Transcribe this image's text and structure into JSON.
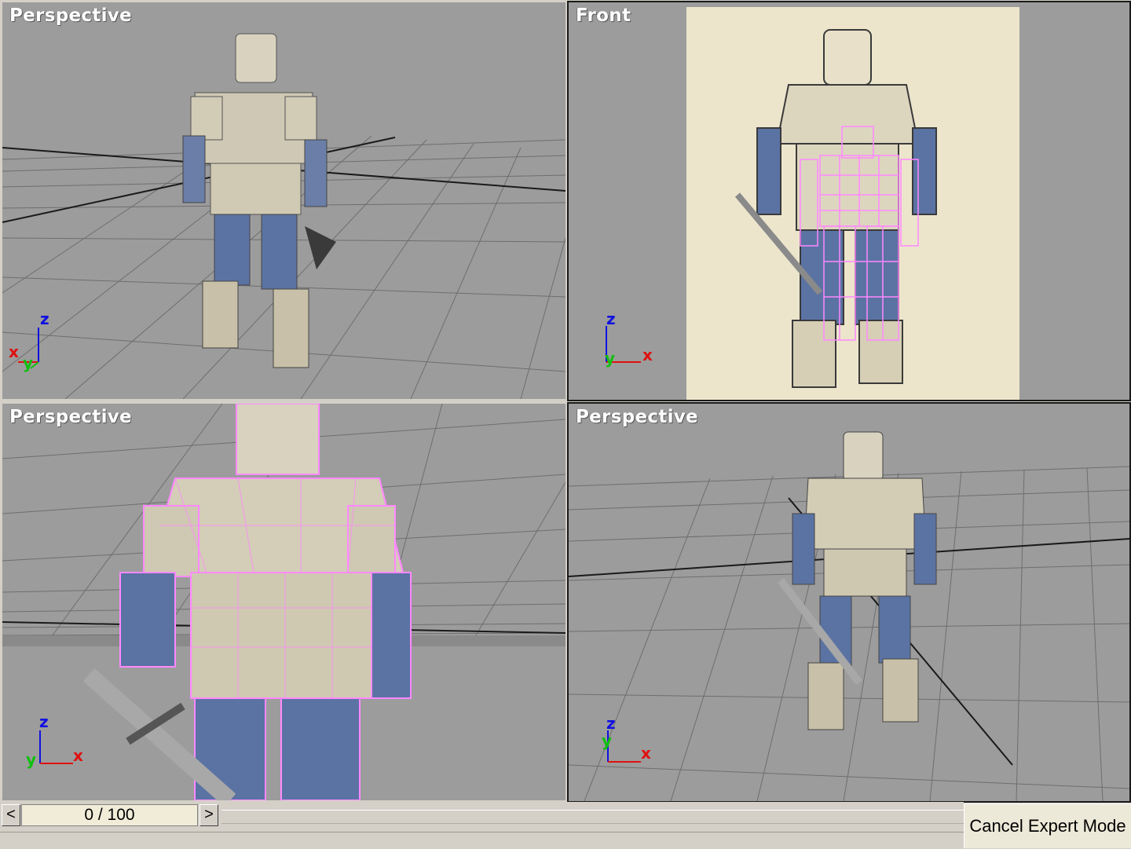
{
  "viewports": [
    {
      "label": "Perspective"
    },
    {
      "label": "Front"
    },
    {
      "label": "Perspective"
    },
    {
      "label": "Perspective"
    }
  ],
  "axes": {
    "x": "x",
    "y": "y",
    "z": "z"
  },
  "colors": {
    "viewport_bg": "#9c9c9c",
    "grid": "#6e6e6e",
    "axis_x": "#e01010",
    "axis_y": "#10c010",
    "axis_z": "#1010e0",
    "wireframe": "#ff88ff",
    "reference_sheet": "#ece5cc"
  },
  "timeline": {
    "prev_label": "<",
    "frame_counter": "0 / 100",
    "next_label": ">"
  },
  "expert_mode": {
    "cancel_label": "Cancel Expert Mode"
  }
}
